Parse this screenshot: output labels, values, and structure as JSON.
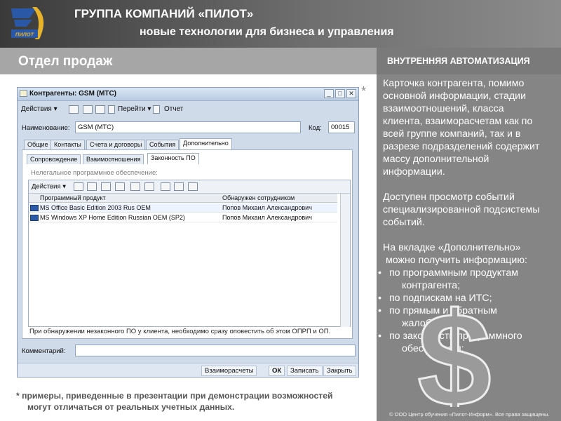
{
  "header": {
    "title": "ГРУППА КОМПАНИЙ «ПИЛОТ»",
    "subtitle": "новые технологии для бизнеса и управления",
    "logo_text": "ПИЛОТ"
  },
  "section_title": "Отдел продаж",
  "right_panel": {
    "title": "ВНУТРЕННЯЯ АВТОМАТИЗАЦИЯ",
    "para1": [
      "Карточка контрагента, помимо",
      "основной информации, стадии",
      "взаимоотношений, класса",
      "клиента, взаиморасчетам как по",
      "всей группе компаний, так и в",
      "разрезе подразделений содержит",
      "массу дополнительной",
      "информации."
    ],
    "para2": [
      "Доступен просмотр событий",
      "специализированной подсистемы",
      "событий."
    ],
    "para3": [
      "На вкладке «Дополнительно»",
      "можно получить информацию:"
    ],
    "bullets": [
      [
        "по программным продуктам",
        "контрагента;"
      ],
      [
        "по подпискам на ИТС;"
      ],
      [
        "по прямым и обратным",
        "жалобам;"
      ],
      [
        "по законности программного",
        "обеспечения;"
      ]
    ],
    "copyright": "© ООО Центр обучения «Пилот-Информ». Все права защищены."
  },
  "footnote": {
    "mark": "*",
    "line1": "* примеры, приведенные в презентации при демонстрации возможностей",
    "line2": "могут отличаться от реальных учетных данных."
  },
  "window": {
    "title": "Контрагенты: GSM (МТС)",
    "toolbar": {
      "actions": "Действия",
      "goto": "Перейти",
      "report": "Отчет"
    },
    "name_label": "Наименование:",
    "name_value": "GSM (МТС)",
    "code_label": "Код:",
    "code_value": "00015",
    "tabs": [
      "Общие",
      "Контакты",
      "Счета и договоры",
      "События",
      "Дополнительно"
    ],
    "subtabs": [
      "Сопровождение",
      "Взаимоотношения",
      "Законность ПО"
    ],
    "section": "Нелегальное программное обеспечение:",
    "grid": {
      "actions": "Действия",
      "columns": [
        "Программный продукт",
        "Обнаружен сотрудником"
      ],
      "rows": [
        {
          "product": "MS Office Basic Edition 2003 Rus OEM",
          "employee": "Попов Михаил Александрович"
        },
        {
          "product": "MS Windows XP Home Edition Russian OEM (SP2)",
          "employee": "Попов Михаил Александрович"
        }
      ]
    },
    "note": "При обнаружении незаконного ПО у клиента, необходимо сразу оповестить об этом ОПРП и ОП.",
    "comment_label": "Комментарий:",
    "buttons": {
      "mutual": "Взаиморасчеты",
      "ok": "ОК",
      "save": "Записать",
      "close": "Закрыть"
    }
  }
}
